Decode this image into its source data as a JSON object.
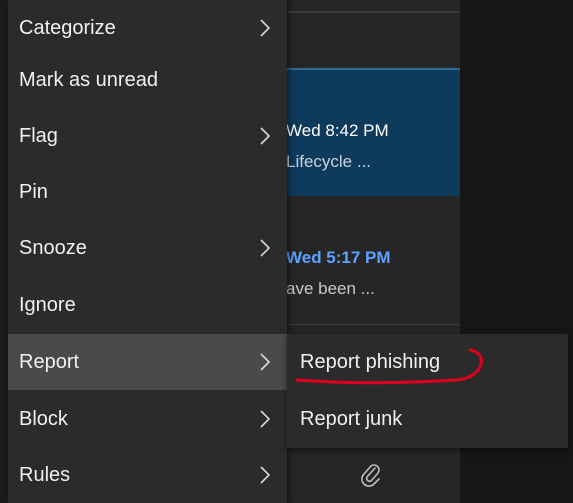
{
  "menu": {
    "items": [
      {
        "label": "Categorize",
        "submenu": true
      },
      {
        "label": "Mark as unread",
        "submenu": false
      },
      {
        "label": "Flag",
        "submenu": true
      },
      {
        "label": "Pin",
        "submenu": false
      },
      {
        "label": "Snooze",
        "submenu": true
      },
      {
        "label": "Ignore",
        "submenu": false
      },
      {
        "label": "Report",
        "submenu": true,
        "active": true
      },
      {
        "label": "Block",
        "submenu": true
      },
      {
        "label": "Rules",
        "submenu": true
      }
    ]
  },
  "submenu": {
    "items": [
      {
        "label": "Report phishing",
        "annotated": true
      },
      {
        "label": "Report junk"
      }
    ],
    "annotation_color": "#e0001b"
  },
  "mail_list": {
    "rows": [
      {
        "time": "Wed 8:42 PM",
        "preview": "Lifecycle ...",
        "selected": true
      },
      {
        "time": "Wed 5:17 PM",
        "preview": "ave been ...",
        "unread": true
      }
    ]
  },
  "colors": {
    "menu_bg": "#2b2b2b",
    "active_item_bg": "#4a4a4a",
    "selected_row_bg": "#0e3a5c",
    "unread_time": "#5ea0ff"
  }
}
